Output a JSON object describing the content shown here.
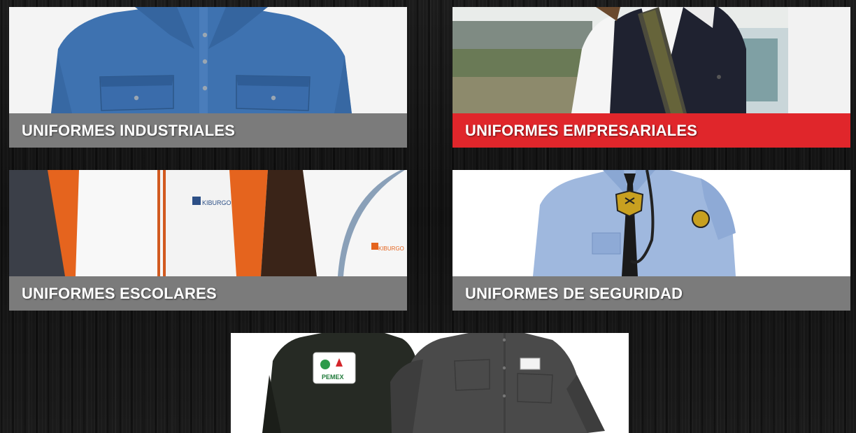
{
  "cards": [
    {
      "label": "UNIFORMES INDUSTRIALES"
    },
    {
      "label": "UNIFORMES EMPRESARIALES"
    },
    {
      "label": "UNIFORMES ESCOLARES"
    },
    {
      "label": "UNIFORMES DE SEGURIDAD"
    }
  ],
  "logos": {
    "pemex": "PEMEX",
    "escolar": "KIBURGO"
  },
  "colors": {
    "caption_default": "#7b7b7b",
    "caption_active": "#e0262b",
    "background": "#141414"
  }
}
